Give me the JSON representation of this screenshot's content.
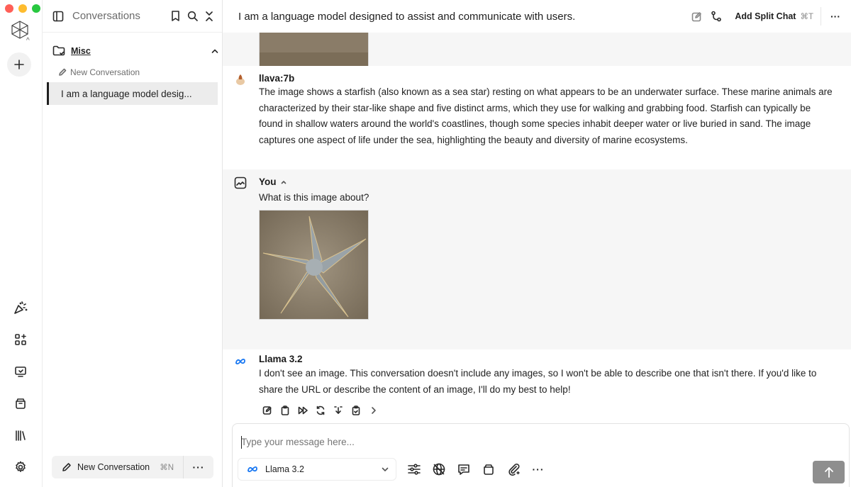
{
  "rail": {
    "traffic_colors": [
      "#ff5f57",
      "#febc2e",
      "#28c840"
    ],
    "items": [
      {
        "name": "magic-icon"
      },
      {
        "name": "apps-add-icon"
      },
      {
        "name": "monitor-icon"
      },
      {
        "name": "archive-icon"
      },
      {
        "name": "library-icon"
      },
      {
        "name": "settings-icon"
      }
    ]
  },
  "sidebar": {
    "title": "Conversations",
    "folder_name": "Misc",
    "new_conversation_link": "New Conversation",
    "conversations": [
      "I am a language model desig..."
    ],
    "footer_button": "New Conversation",
    "footer_shortcut": "⌘N",
    "footer_more": "···"
  },
  "header": {
    "title": "I am a language model designed to assist and communicate with users.",
    "split_label": "Add Split Chat",
    "split_shortcut": "⌘T",
    "more": "···"
  },
  "messages": [
    {
      "sender": "llava:7b",
      "text": "The image shows a starfish (also known as a sea star) resting on what appears to be an underwater surface. These marine animals are characterized by their star-like shape and five distinct arms, which they use for walking and grabbing food. Starfish can typically be found in shallow waters around the world's coastlines, though some species inhabit deeper water or live buried in sand. The image captures one aspect of life under the sea, highlighting the beauty and diversity of marine ecosystems."
    },
    {
      "sender": "You",
      "text": "What is this image about?",
      "image": "starfish photo"
    },
    {
      "sender": "Llama 3.2",
      "text": "I don't see an image. This conversation doesn't include any images, so I won't be able to describe one that isn't there. If you'd like to share the URL or describe the content of an image, I'll do my best to help!"
    }
  ],
  "composer": {
    "placeholder": "Type your message here...",
    "model": "Llama 3.2"
  },
  "colors": {
    "accent": "#1877f2",
    "send_button": "#8e8e8e",
    "selected_row": "#ececec"
  }
}
